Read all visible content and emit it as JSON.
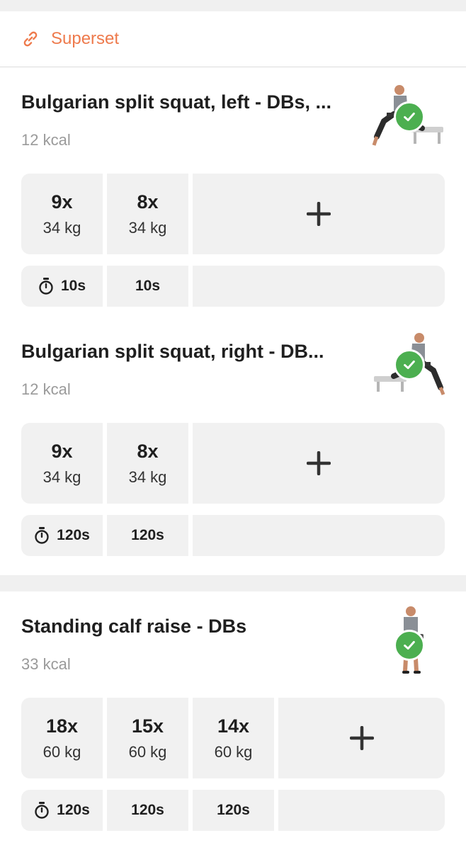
{
  "superset": {
    "label": "Superset",
    "icon": "link-icon",
    "color": "#ee7a4c"
  },
  "exercises": [
    {
      "title": "Bulgarian split squat, left - DBs, ...",
      "kcal": "12 kcal",
      "sets": [
        {
          "reps": "9x",
          "weight": "34 kg"
        },
        {
          "reps": "8x",
          "weight": "34 kg"
        }
      ],
      "rests": [
        "10s",
        "10s"
      ],
      "completed": true
    },
    {
      "title": "Bulgarian split squat, right - DB...",
      "kcal": "12 kcal",
      "sets": [
        {
          "reps": "9x",
          "weight": "34 kg"
        },
        {
          "reps": "8x",
          "weight": "34 kg"
        }
      ],
      "rests": [
        "120s",
        "120s"
      ],
      "completed": true
    },
    {
      "title": "Standing calf raise - DBs",
      "kcal": "33 kcal",
      "sets": [
        {
          "reps": "18x",
          "weight": "60 kg"
        },
        {
          "reps": "15x",
          "weight": "60 kg"
        },
        {
          "reps": "14x",
          "weight": "60 kg"
        }
      ],
      "rests": [
        "120s",
        "120s",
        "120s"
      ],
      "completed": true
    }
  ],
  "colors": {
    "accent": "#ee7a4c",
    "check": "#4caf50",
    "cell_bg": "#f1f1f1"
  }
}
